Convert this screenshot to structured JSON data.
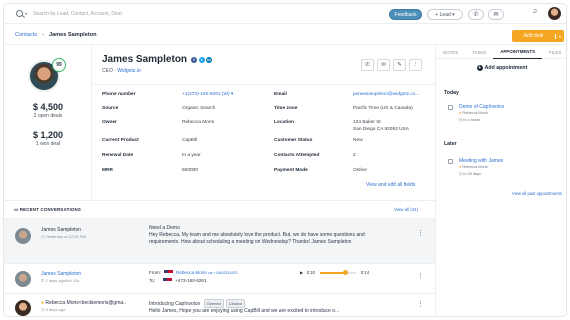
{
  "topbar": {
    "search_placeholder": "Search by Lead, Contact, Account, Deal",
    "feedback_label": "Feedback",
    "lead_label": "+ Lead",
    "accent": "#f5a623",
    "feedback_color": "#4c8fb8"
  },
  "breadcrumb": {
    "parent": "Contacts",
    "current": "James Sampleton"
  },
  "add_deal_label": "Add deal",
  "profile": {
    "score": "99",
    "open_deals_value": "$ 4,500",
    "open_deals_label": "2 open deals",
    "won_deals_value": "$ 1,200",
    "won_deals_label": "1 won deal",
    "name": "James Sampleton",
    "title": "CEO",
    "company": "Widgetz.io"
  },
  "details": {
    "phone_label": "Phone number",
    "phone_value": "+1(473)-160-8261 (W)",
    "email_label": "Email",
    "email_value": "jamessampleton@widgetz.co...",
    "source_label": "Source",
    "source_value": "Organic Search",
    "timezone_label": "Time zone",
    "timezone_value": "Pacific Time (US & Canada)",
    "owner_label": "Owner",
    "owner_value": "Rebecca Moris",
    "location_label": "Location",
    "location_value_1": "134 Baker St",
    "location_value_2": "San Diego CA 92093 USA",
    "product_label": "Current Product",
    "product_value": "CapBill",
    "status_label": "Customer Status",
    "status_value": "New",
    "renewal_label": "Renewal Date",
    "renewal_value": "In a year",
    "attempted_label": "Contacts Attempted",
    "attempted_value": "2",
    "mrr_label": "MRR",
    "mrr_value": "500000",
    "payment_label": "Payment Mode",
    "payment_value": "Online",
    "view_all": "View and edit all fields"
  },
  "right": {
    "tabs": [
      "NOTES",
      "TASKS",
      "APPOINTMENTS",
      "FILES"
    ],
    "add_appointment": "Add appointment",
    "today_label": "Today",
    "today_title": "Demo of CapInvoice",
    "today_who": "Rebecca Moris",
    "today_when": "In 4 hours",
    "later_label": "Later",
    "later_title": "Meeting with James",
    "later_who": "Rebecca Moris",
    "later_when": "In 20 days",
    "view_past": "View all past appointments"
  },
  "recent": {
    "header": "RECENT CONVERSATIONS",
    "view_all": "View all (24)",
    "c1_name": "James Sampleton",
    "c1_date": "Yesterday at 12:32 PM",
    "c1_subject": "Need a Demo",
    "c1_body": "Hey Rebecca, My team and me absolutely love the product. But, we do have some questions and requirements. How about scheduling a meeting on Wednesday? Thanks! James Sampleton",
    "c2_name": "James Sampleton",
    "c2_date": "2 days ago/6m 13s",
    "c2_from_label": "From:",
    "c2_from": "Rebecca Moris",
    "c2_from_num": "via +16602511923",
    "c2_to_label": "To:",
    "c2_to": "+473-160-8261",
    "c2_time_start": "0:10",
    "c2_time_end": "0:14",
    "c2_progress": 0.7,
    "c3_name": "Rebecca Moris<beckiemoris@gma..",
    "c3_date": "4 days ago",
    "c3_subject": "Introducing CapInvoice",
    "c3_badge1": "Opened",
    "c3_badge2": "Clicked",
    "c3_body": "Hello James, Hope you are enjoying using CapBill and we are excited to introduce o..."
  }
}
